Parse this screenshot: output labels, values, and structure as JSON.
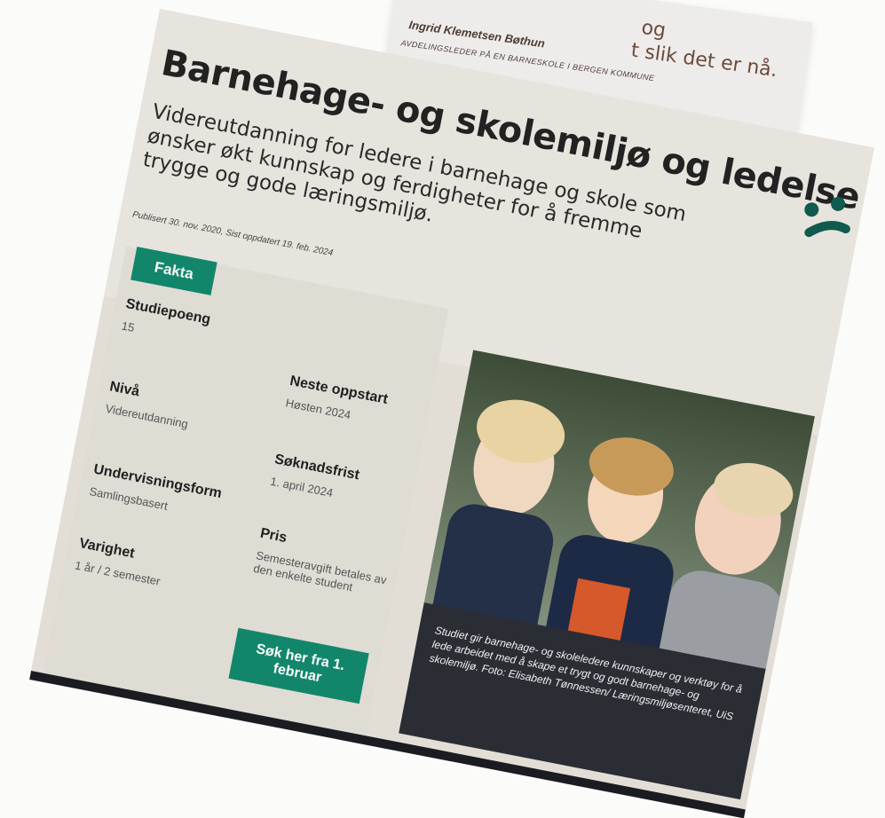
{
  "quote": {
    "text_line1": "og",
    "text_line2": "t slik det er nå.",
    "author": "Ingrid Klemetsen Bøthun",
    "role": "AVDELINGSLEDER PÅ EN BARNESKOLE I BERGEN KOMMUNE"
  },
  "page": {
    "title": "Barnehage- og skolemiljø og ledelse",
    "lead": "Videreutdanning for ledere i barnehage og skole som ønsker økt kunnskap og ferdigheter for å fremme trygge og gode læringsmiljø.",
    "meta": "Publisert 30. nov. 2020, Sist oppdatert 19. feb. 2024"
  },
  "facts": {
    "tab_label": "Fakta",
    "items_left": [
      {
        "label": "Studiepoeng",
        "value": "15"
      },
      {
        "label": "Nivå",
        "value": "Videreutdanning"
      },
      {
        "label": "Undervisningsform",
        "value": "Samlingsbasert"
      },
      {
        "label": "Varighet",
        "value": "1 år / 2 semester"
      }
    ],
    "items_right": [
      {
        "label": "Neste oppstart",
        "value": "Høsten 2024"
      },
      {
        "label": "Søknadsfrist",
        "value": "1. april 2024"
      },
      {
        "label": "Pris",
        "value": "Semesteravgift betales av den enkelte student"
      }
    ],
    "cta_label": "Søk her fra 1. februar"
  },
  "photo": {
    "caption": "Studiet gir barnehage- og skoleledere kunnskaper og verktøy for å lede arbeidet med å skape et trygt og godt barnehage- og skolemiljø. Foto: Elisabeth Tønnessen/ Læringsmiljøsenteret, UiS"
  },
  "colors": {
    "accent": "#12866b",
    "caption_bg": "#2b2d34",
    "logo": "#0f5b4d"
  }
}
